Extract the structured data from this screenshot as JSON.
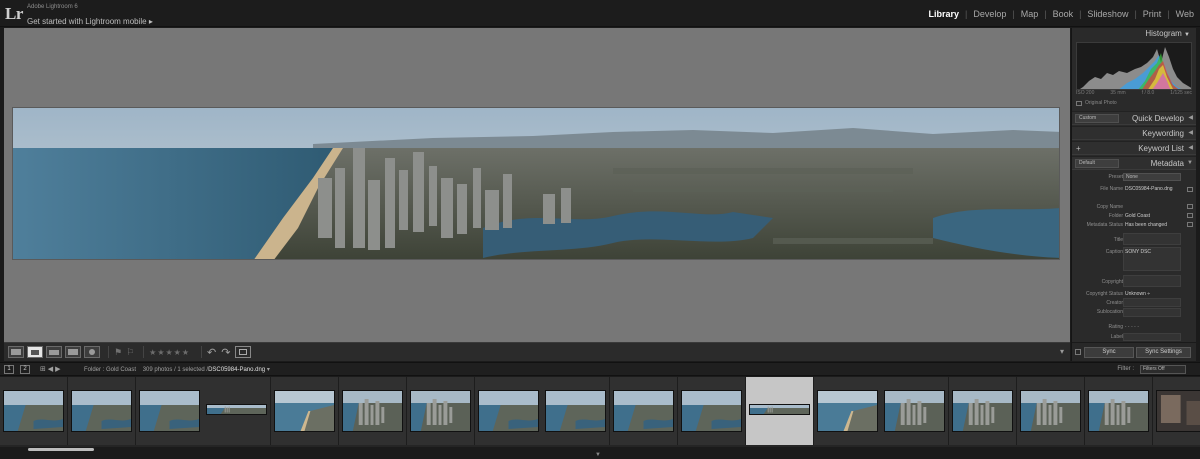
{
  "app": {
    "logo": "Lr",
    "product_name": "Adobe Lightroom 6",
    "subtitle": "Get started with Lightroom mobile",
    "subtitle_arrow": "▸"
  },
  "modules": [
    {
      "label": "Library",
      "active": true
    },
    {
      "label": "Develop",
      "active": false
    },
    {
      "label": "Map",
      "active": false
    },
    {
      "label": "Book",
      "active": false
    },
    {
      "label": "Slideshow",
      "active": false
    },
    {
      "label": "Print",
      "active": false
    },
    {
      "label": "Web",
      "active": false
    }
  ],
  "module_separator": "|",
  "toolbar": {
    "stars": "★★★★★",
    "rotate_left": "↶",
    "rotate_right": "↷",
    "dropdown": "▾"
  },
  "right_panel": {
    "histogram_title": "Histogram",
    "histogram_info": [
      "ISO 200",
      "35 mm",
      "f / 8.0",
      "1/125 sec"
    ],
    "original_photo": "Original Photo",
    "quick_develop": "Quick Develop",
    "quick_develop_preset": "Custom",
    "keywording": "Keywording",
    "keyword_list": "Keyword List",
    "keyword_plus": "+",
    "metadata": "Metadata",
    "metadata_preset": "Default",
    "triangle_down": "▼",
    "triangle_left": "◀",
    "meta_fields": {
      "preset_label": "Preset",
      "preset_value": "None",
      "file_name_label": "File Name",
      "file_name_value": "DSC05984-Pano.dng",
      "copy_name_label": "Copy Name",
      "folder_label": "Folder",
      "folder_value": "Gold Coast",
      "metadata_status_label": "Metadata Status",
      "metadata_status_value": "Has been changed",
      "title_label": "Title",
      "caption_label": "Caption",
      "caption_value": "SONY DSC",
      "copyright_label": "Copyright",
      "copyright_status_label": "Copyright Status",
      "copyright_status_value": "Unknown ÷",
      "creator_label": "Creator",
      "sublocation_label": "Sublocation",
      "rating_label": "Rating",
      "rating_value": "· · · · ·",
      "label_label": "Label"
    },
    "sync_label": "Sync",
    "sync_settings_label": "Sync Settings"
  },
  "filmstrip_header": {
    "screen1": "1",
    "screen2": "2",
    "nav": "⊞  ◀  ▶",
    "folder_text": "Folder : Gold Coast",
    "count_text": "309 photos / 1 selected /",
    "selected_file": "DSC05984-Pano.dng",
    "dropdown": "▾",
    "filter_label": "Filter :",
    "filter_value": "Filters Off"
  },
  "filmstrip": {
    "thumbnails": [
      {
        "kind": "aerial",
        "selected": false
      },
      {
        "kind": "aerial",
        "selected": false
      },
      {
        "kind": "aerial",
        "selected": false
      },
      {
        "kind": "pano",
        "selected": false
      },
      {
        "kind": "beach",
        "selected": false
      },
      {
        "kind": "city",
        "selected": false
      },
      {
        "kind": "city",
        "selected": false
      },
      {
        "kind": "aerial",
        "selected": false
      },
      {
        "kind": "aerial",
        "selected": false
      },
      {
        "kind": "aerial",
        "selected": false
      },
      {
        "kind": "aerial",
        "selected": false
      },
      {
        "kind": "pano",
        "selected": true
      },
      {
        "kind": "beach",
        "selected": false
      },
      {
        "kind": "city",
        "selected": false
      },
      {
        "kind": "city",
        "selected": false
      },
      {
        "kind": "city",
        "selected": false
      },
      {
        "kind": "city",
        "selected": false
      },
      {
        "kind": "room",
        "selected": false
      }
    ]
  },
  "colors": {
    "sky": "#a9bccb",
    "ocean": "#3f6f8c",
    "land": "#5d6256",
    "accent": "#ffffff"
  }
}
